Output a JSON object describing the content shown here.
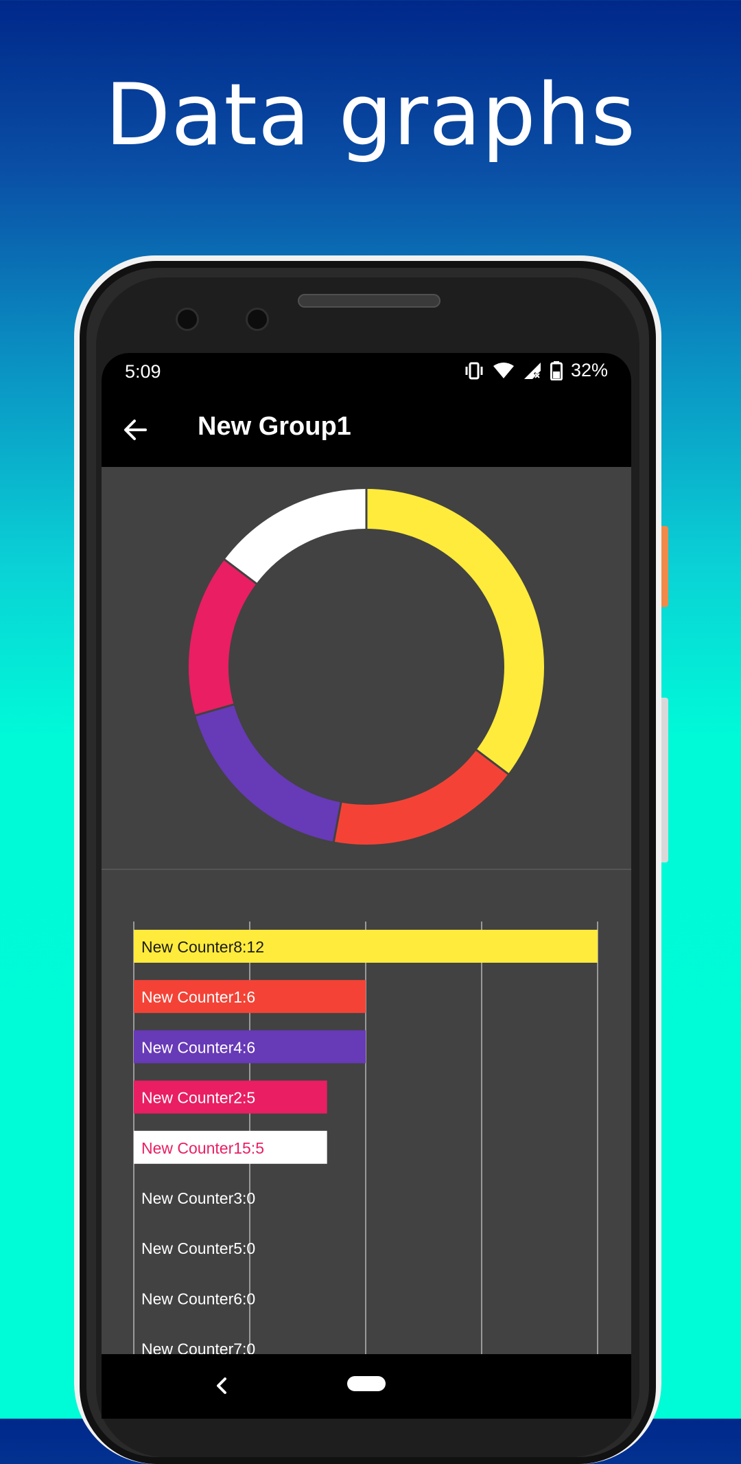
{
  "promo": {
    "headline": "Data graphs"
  },
  "status": {
    "time": "5:09",
    "battery": "32%",
    "icons": [
      "vibrate-icon",
      "wifi-icon",
      "signal-off-icon",
      "battery-icon"
    ]
  },
  "appbar": {
    "title": "New Group1",
    "back_icon": "arrow-left-icon"
  },
  "colors": {
    "yellow": "#ffeb3b",
    "red": "#f44336",
    "purple": "#673ab7",
    "pink": "#e91e63",
    "white": "#ffffff",
    "screen_bg": "#424242",
    "bar_text_dark": "#1a1a1a",
    "bar_text_light": "#ffffff"
  },
  "chart_data": [
    {
      "type": "pie",
      "variant": "donut",
      "labels": [
        "New Counter8",
        "New Counter1",
        "New Counter4",
        "New Counter2",
        "New Counter15",
        "New Counter3",
        "New Counter5",
        "New Counter6",
        "New Counter7"
      ],
      "values": [
        12,
        6,
        6,
        5,
        5,
        0,
        0,
        0,
        0
      ],
      "colors": [
        "#ffeb3b",
        "#f44336",
        "#673ab7",
        "#e91e63",
        "#ffffff",
        "#9e9e9e",
        "#9e9e9e",
        "#9e9e9e",
        "#9e9e9e"
      ]
    },
    {
      "type": "bar",
      "orientation": "horizontal",
      "categories": [
        "New Counter8",
        "New Counter1",
        "New Counter4",
        "New Counter2",
        "New Counter15",
        "New Counter3",
        "New Counter5",
        "New Counter6",
        "New Counter7"
      ],
      "values": [
        12,
        6,
        6,
        5,
        5,
        0,
        0,
        0,
        0
      ],
      "labels": [
        "New Counter8:12",
        "New Counter1:6",
        "New Counter4:6",
        "New Counter2:5",
        "New Counter15:5",
        "New Counter3:0",
        "New Counter5:0",
        "New Counter6:0",
        "New Counter7:0"
      ],
      "colors": [
        "#ffeb3b",
        "#f44336",
        "#673ab7",
        "#e91e63",
        "#ffffff",
        "#9e9e9e",
        "#9e9e9e",
        "#9e9e9e",
        "#9e9e9e"
      ],
      "label_colors": [
        "#1a1a1a",
        "#ffffff",
        "#ffffff",
        "#ffffff",
        "#e91e63",
        "#ffffff",
        "#ffffff",
        "#ffffff",
        "#ffffff"
      ],
      "xlim": [
        0,
        12
      ],
      "grid": true
    }
  ]
}
